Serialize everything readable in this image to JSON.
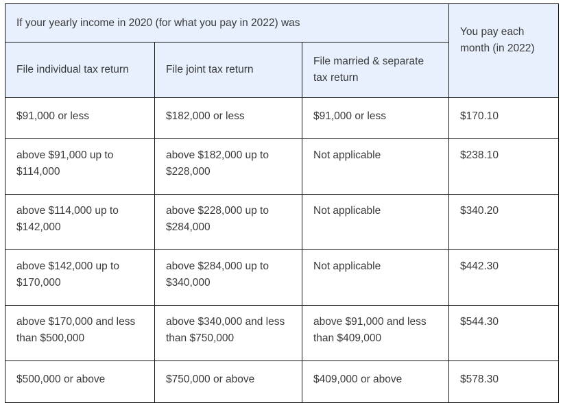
{
  "table": {
    "header": {
      "income_group_label": "If your yearly income in 2020 (for what you pay in 2022) was",
      "columns": [
        "File individual tax return",
        "File joint tax return",
        "File married & separate tax return"
      ],
      "payment_label": "You pay each month (in 2022)"
    },
    "rows": [
      {
        "individual": "$91,000 or less",
        "joint": "$182,000 or less",
        "married_separate": "$91,000 or less",
        "monthly_payment": "$170.10"
      },
      {
        "individual": "above $91,000 up to $114,000",
        "joint": "above $182,000 up to $228,000",
        "married_separate": "Not applicable",
        "monthly_payment": "$238.10"
      },
      {
        "individual": "above $114,000 up to $142,000",
        "joint": "above $228,000 up to $284,000",
        "married_separate": "Not applicable",
        "monthly_payment": "$340.20"
      },
      {
        "individual": "above $142,000 up to $170,000",
        "joint": "above $284,000 up to $340,000",
        "married_separate": "Not applicable",
        "monthly_payment": "$442.30"
      },
      {
        "individual": "above $170,000 and less than $500,000",
        "joint": "above $340,000 and less than $750,000",
        "married_separate": "above $91,000 and less than $409,000",
        "monthly_payment": "$544.30"
      },
      {
        "individual": "$500,000 or above",
        "joint": "$750,000 or above",
        "married_separate": "$409,000 or above",
        "monthly_payment": "$578.30"
      }
    ]
  }
}
